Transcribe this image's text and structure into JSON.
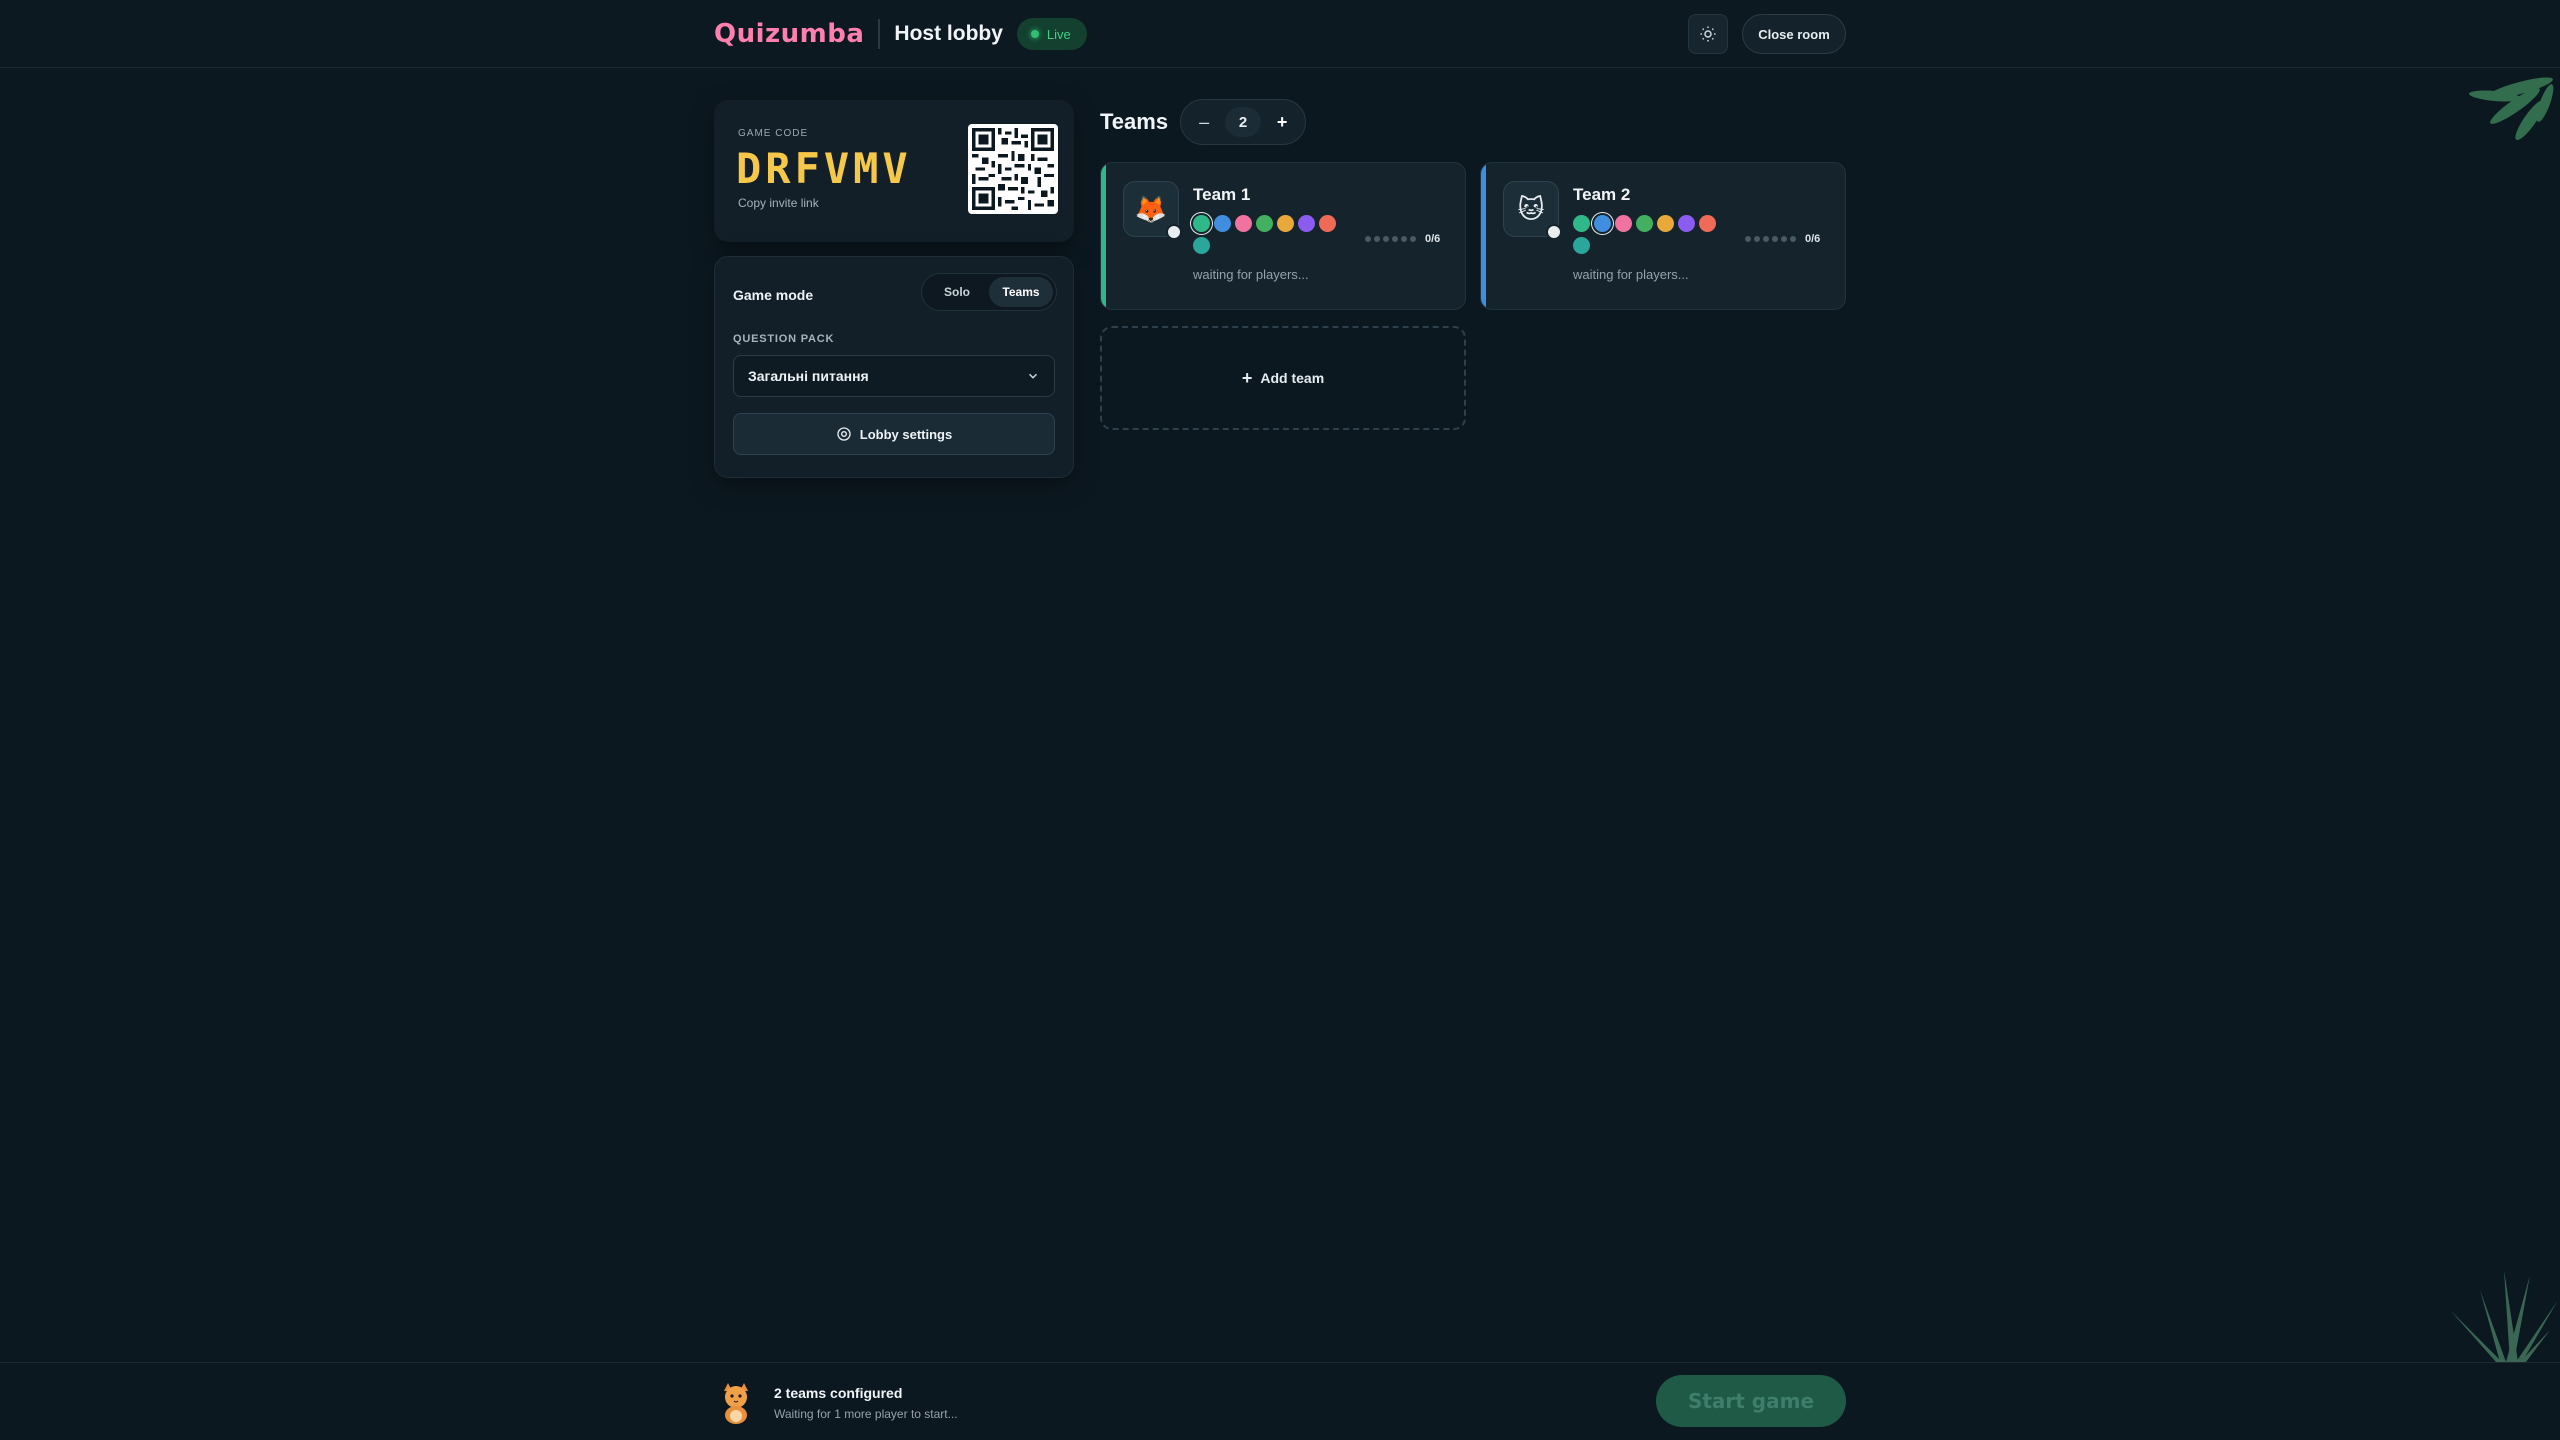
{
  "header": {
    "brand": "Quizumba",
    "title": "Host lobby",
    "live_label": "Live",
    "close_room": "Close room"
  },
  "code_card": {
    "label": "GAME CODE",
    "code": "DRFVMV",
    "copy_link": "Copy invite link"
  },
  "settings": {
    "game_mode_label": "Game mode",
    "modes": [
      "Solo",
      "Teams"
    ],
    "active_mode": "Teams",
    "question_pack_label": "QUESTION PACK",
    "question_pack_value": "Загальні питання",
    "lobby_settings": "Lobby settings"
  },
  "teams": {
    "title": "Teams",
    "count": "2",
    "list": [
      {
        "name": "Team 1",
        "emoji": "🦊",
        "accent": "#2fb98a",
        "players": "0/6",
        "status": "waiting for players...",
        "colors": [
          "#2fb98a",
          "#3f8ee0",
          "#f0739f",
          "#43b05f",
          "#e8a83a",
          "#8a5cf0",
          "#f06a58",
          "#2aa69a"
        ],
        "selected_color": 0
      },
      {
        "name": "Team 2",
        "emoji": "🐱",
        "accent": "#3f8ee0",
        "players": "0/6",
        "status": "waiting for players...",
        "colors": [
          "#2fb98a",
          "#3f8ee0",
          "#f0739f",
          "#43b05f",
          "#e8a83a",
          "#8a5cf0",
          "#f06a58",
          "#2aa69a"
        ],
        "selected_color": 1
      }
    ],
    "add_team": "Add team"
  },
  "footer": {
    "title": "2 teams configured",
    "subtitle": "Waiting for 1 more player to start...",
    "start_game": "Start game"
  }
}
